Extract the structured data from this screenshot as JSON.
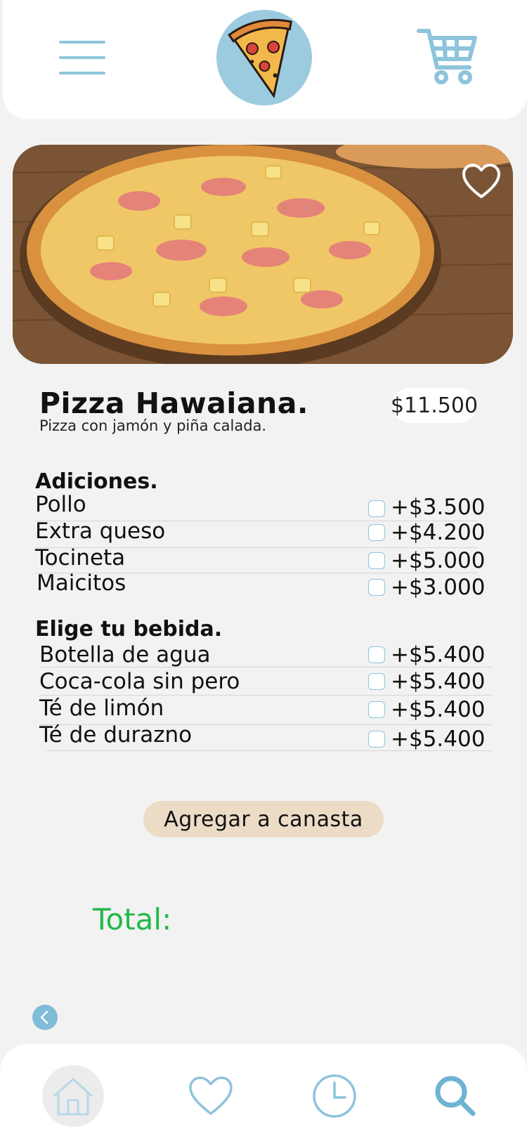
{
  "header": {
    "menu_icon": "hamburger-menu-icon",
    "logo_icon": "pizza-slice-logo",
    "cart_icon": "shopping-cart-icon"
  },
  "hero": {
    "favorite_icon": "heart-outline-icon"
  },
  "product": {
    "name": "Pizza Hawaiana.",
    "description": "Pizza con jamón y piña calada.",
    "price": "$11.500"
  },
  "additions": {
    "title": "Adiciones.",
    "items": [
      {
        "name": "Pollo",
        "price": "+$3.500"
      },
      {
        "name": "Extra queso",
        "price": "+$4.200"
      },
      {
        "name": "Tocineta",
        "price": "+$5.000"
      },
      {
        "name": "Maicitos",
        "price": "+$3.000"
      }
    ]
  },
  "drinks": {
    "title": "Elige tu bebida.",
    "items": [
      {
        "name": "Botella de agua",
        "price": "+$5.400"
      },
      {
        "name": "Coca-cola sin pero",
        "price": "+$5.400"
      },
      {
        "name": "Té de limón",
        "price": "+$5.400"
      },
      {
        "name": "Té de durazno",
        "price": "+$5.400"
      }
    ]
  },
  "actions": {
    "add_to_basket": "Agregar a canasta"
  },
  "total": {
    "label": "Total:"
  },
  "bottom_nav": [
    "home-icon",
    "heart-icon",
    "clock-icon",
    "search-icon"
  ],
  "colors": {
    "accent": "#8ec4dc",
    "button_bg": "#ecdcc6",
    "total_green": "#23b84a",
    "background": "#f2f2f2"
  }
}
